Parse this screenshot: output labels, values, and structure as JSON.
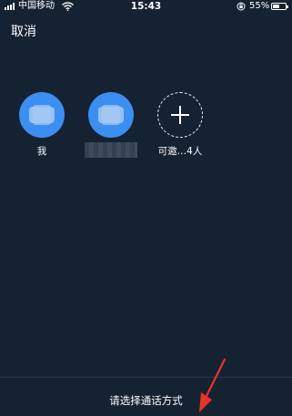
{
  "status_bar": {
    "carrier": "中国移动",
    "time": "15:43",
    "battery": "55%",
    "battery_level": 0.55
  },
  "header": {
    "cancel_label": "取消"
  },
  "participants": [
    {
      "name": "我"
    },
    {
      "name": ""
    }
  ],
  "invite": {
    "label": "可邀…4人",
    "icon": "plus-icon"
  },
  "bottom": {
    "prompt": "请选择通话方式"
  },
  "colors": {
    "background": "#152232",
    "avatar": "#3a8ff1",
    "annotation_arrow": "#e8332a"
  }
}
